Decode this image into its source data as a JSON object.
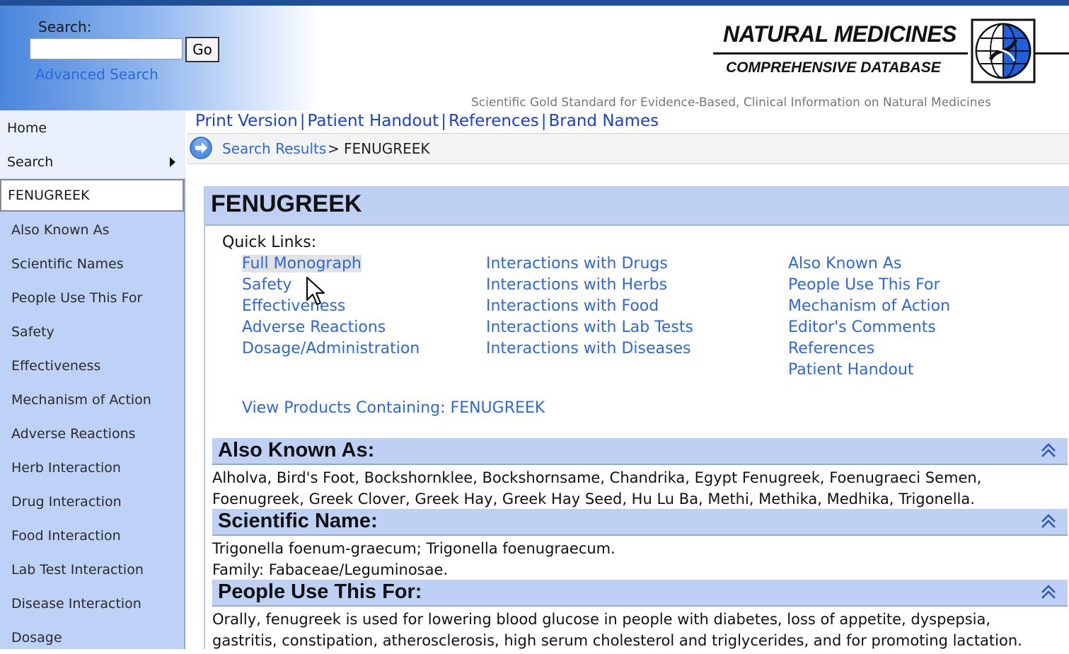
{
  "header": {
    "search_label": "Search:",
    "search_value": "",
    "go_label": "Go",
    "advanced_search": "Advanced Search",
    "logo_title": "NATURAL MEDICINES",
    "logo_subtitle": "COMPREHENSIVE DATABASE",
    "tagline": "Scientific Gold Standard for Evidence-Based, Clinical Information on Natural Medicines"
  },
  "sidebar": {
    "top_items": [
      {
        "label": "Home"
      },
      {
        "label": "Search"
      }
    ],
    "current": "FENUGREEK",
    "sub_items": [
      {
        "label": "Also Known As"
      },
      {
        "label": "Scientific Names"
      },
      {
        "label": "People Use This For"
      },
      {
        "label": "Safety"
      },
      {
        "label": "Effectiveness"
      },
      {
        "label": "Mechanism of Action"
      },
      {
        "label": "Adverse Reactions"
      },
      {
        "label": "Herb Interaction"
      },
      {
        "label": "Drug Interaction"
      },
      {
        "label": "Food Interaction"
      },
      {
        "label": "Lab Test Interaction"
      },
      {
        "label": "Disease Interaction"
      },
      {
        "label": "Dosage"
      }
    ]
  },
  "tabs": {
    "print": "Print Version",
    "handout": "Patient Handout",
    "references": "References",
    "brands": "Brand Names",
    "separator": "|"
  },
  "breadcrumb": {
    "link": "Search Results",
    "separator": ">",
    "current": "FENUGREEK"
  },
  "main": {
    "title": "FENUGREEK",
    "quick_links_label": "Quick Links:",
    "quick_links": {
      "col1": [
        "Full Monograph",
        "Safety",
        "Effectiveness",
        "Adverse Reactions",
        "Dosage/Administration"
      ],
      "col2": [
        "Interactions with Drugs",
        "Interactions with Herbs",
        "Interactions with Food",
        "Interactions with Lab Tests",
        "Interactions with Diseases"
      ],
      "col3": [
        "Also Known As",
        "People Use This For",
        "Mechanism of Action",
        "Editor's Comments",
        "References",
        "Patient Handout"
      ]
    },
    "view_products": "View Products Containing: FENUGREEK",
    "sections": [
      {
        "title": "Also Known As:",
        "lines": [
          "Alholva, Bird's Foot, Bockshornklee, Bockshornsame, Chandrika, Egypt Fenugreek, Foenugraeci Semen,",
          "Foenugreek, Greek Clover, Greek Hay, Greek Hay Seed, Hu Lu Ba, Methi, Methika, Medhika, Trigonella."
        ]
      },
      {
        "title": "Scientific Name:",
        "lines": [
          "Trigonella foenum-graecum; Trigonella foenugraecum.",
          "Family: Fabaceae/Leguminosae."
        ]
      },
      {
        "title": "People Use This For:",
        "lines": [
          "Orally, fenugreek is used for lowering blood glucose in people with diabetes, loss of appetite, dyspepsia,",
          "gastritis, constipation, atherosclerosis, high serum cholesterol and triglycerides, and for promoting lactation."
        ]
      }
    ]
  },
  "colors": {
    "link": "#2d68d8",
    "tab_link": "#1a3fd0",
    "section_bg": "#bed1f5",
    "sidebar_bg": "#bdd2f6"
  }
}
